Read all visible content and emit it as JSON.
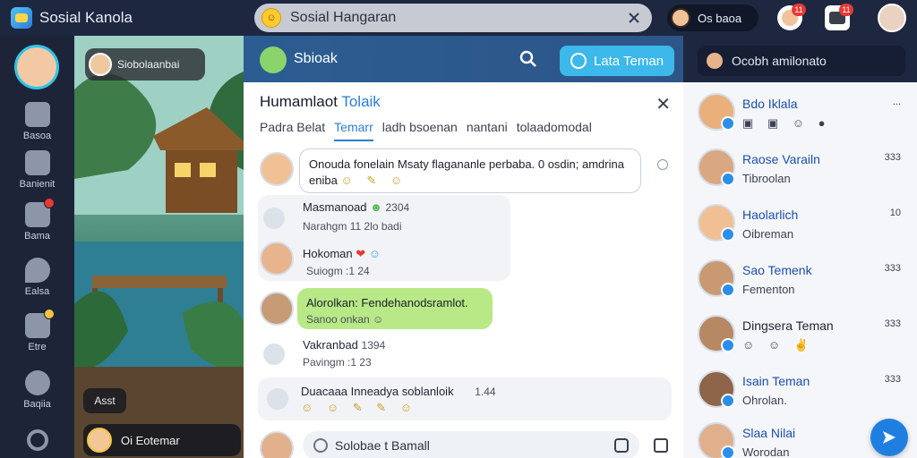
{
  "app": {
    "title": "Sosial Kanola"
  },
  "topbar": {
    "search_placeholder": "Sosial Hangaran",
    "user_name": "Os baoa",
    "notif_badge": "11",
    "messages_badge": "11"
  },
  "leftnav": {
    "items": [
      {
        "label": "Basoa",
        "icon": "puzzle-icon"
      },
      {
        "label": "Banienit",
        "icon": "calendar-icon"
      },
      {
        "label": "Bama",
        "icon": "games-icon"
      },
      {
        "label": "Ealsa",
        "icon": "location-icon"
      },
      {
        "label": "Etre",
        "icon": "list-icon"
      },
      {
        "label": "Baqiia",
        "icon": "emoji-icon"
      }
    ]
  },
  "scene": {
    "room_label": "Siobolaanbai",
    "online_label": "Asst",
    "member_label": "Oi Eotemar"
  },
  "chat_header": {
    "title": "Sbioak",
    "add_friend_label": "Lata Teman"
  },
  "chat": {
    "title_plain": "Humamlaot",
    "title_accent": "Tolaik",
    "tabs": [
      "Padra Belat",
      "Temarr",
      "ladh bsoenan",
      "nantani",
      "tolaadomodal"
    ],
    "messages": [
      {
        "text": "Onouda fonelain Msaty flagananle perbaba. 0 osdin; amdrina",
        "tail": "eniba"
      },
      {
        "title": "Masmanoad",
        "time": "2304",
        "sub": "Narahgm 11 2lo badi"
      },
      {
        "title": "Hokoman",
        "sub": "Suiogm :1 24"
      },
      {
        "title": "Alorolkan: Fendehanodsramlot.",
        "sub": "Sanoo onkan"
      },
      {
        "title": "Vakranbad",
        "time": "1394",
        "sub": "Pavingm :1 23"
      },
      {
        "title": "Duacaaa Inneadya soblanloik",
        "time": "1.44"
      }
    ],
    "composer_placeholder": "Solobae t Bamall"
  },
  "friends": {
    "header": "Ocobh amilonato",
    "items": [
      {
        "name": "Bdo Iklala",
        "status": "",
        "meta": "..."
      },
      {
        "name": "Raose Varailn",
        "status": "Tibroolan",
        "meta": "333"
      },
      {
        "name": "Haolarlich",
        "status": "Oibreman",
        "meta": "10"
      },
      {
        "name": "Sao Temenk",
        "status": "Fementon",
        "meta": "333"
      },
      {
        "name": "Dingsera Teman",
        "status": "",
        "meta": "333"
      },
      {
        "name": "Isain Teman",
        "status": "Ohrolan.",
        "meta": "333"
      },
      {
        "name": "Slaa Nilai",
        "status": "Worodan",
        "meta": ""
      }
    ]
  }
}
